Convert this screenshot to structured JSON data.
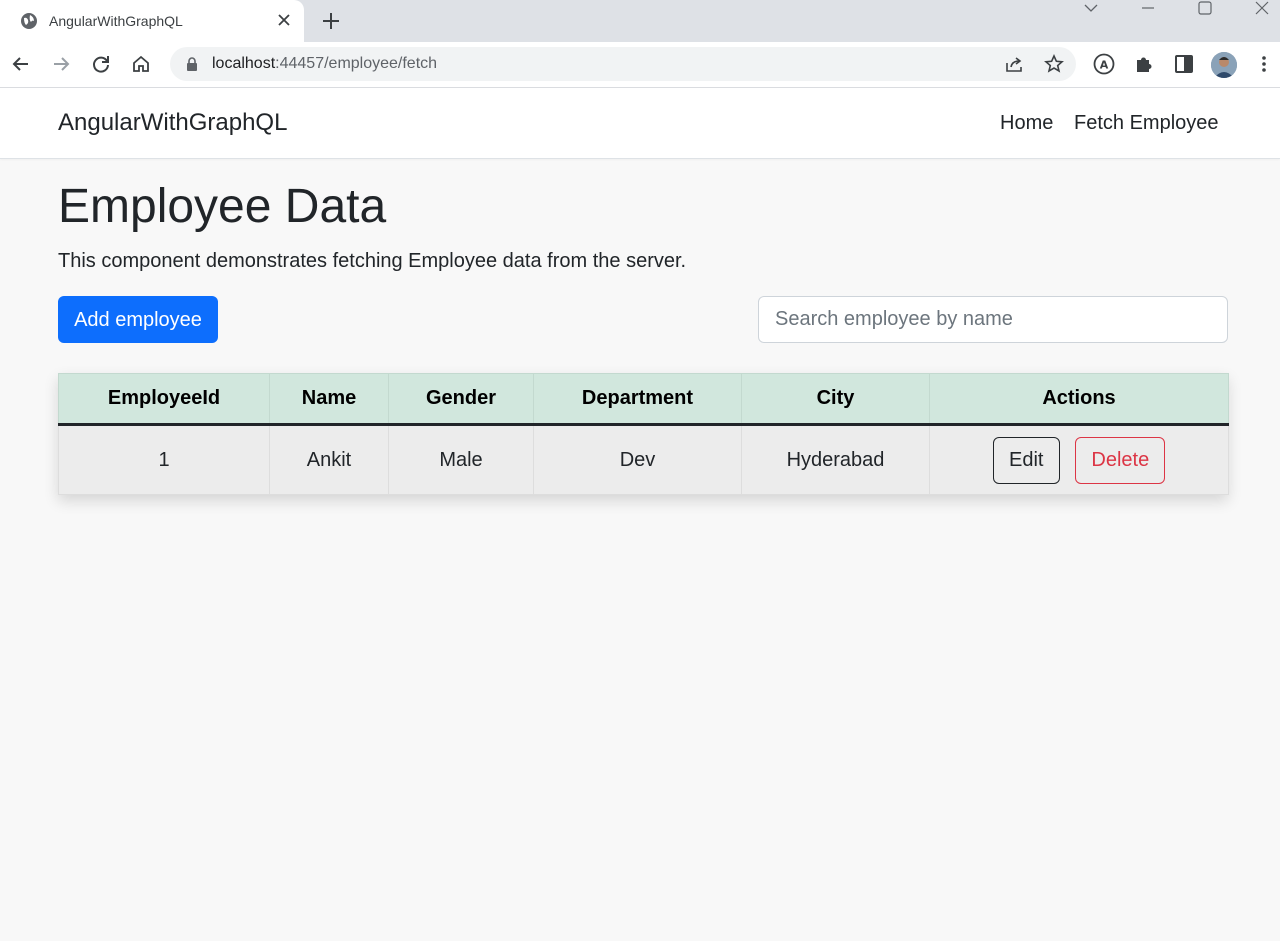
{
  "browser": {
    "tab": {
      "title": "AngularWithGraphQL",
      "favicon": "globe-icon"
    },
    "address_bar": {
      "host": "localhost",
      "path": ":44457/employee/fetch"
    },
    "icons": [
      "back-icon",
      "forward-icon",
      "reload-icon",
      "home-icon",
      "lock-icon",
      "share-icon",
      "star-icon",
      "extension-a-icon",
      "puzzle-icon",
      "side-panel-icon",
      "avatar",
      "more-vert-icon"
    ]
  },
  "navbar": {
    "brand": "AngularWithGraphQL",
    "links": [
      "Home",
      "Fetch Employee"
    ]
  },
  "main": {
    "title": "Employee Data",
    "description": "This component demonstrates fetching Employee data from the server.",
    "add_button": "Add employee",
    "search": {
      "placeholder": "Search employee by name",
      "value": ""
    },
    "table": {
      "headers": [
        "EmployeeId",
        "Name",
        "Gender",
        "Department",
        "City",
        "Actions"
      ],
      "rows": [
        {
          "id": "1",
          "name": "Ankit",
          "gender": "Male",
          "department": "Dev",
          "city": "Hyderabad",
          "edit": "Edit",
          "delete": "Delete"
        }
      ]
    }
  },
  "colors": {
    "primary": "#0d6efd",
    "danger": "#dc3545",
    "table_header": "#d1e7dd",
    "row_bg": "#ececec"
  }
}
